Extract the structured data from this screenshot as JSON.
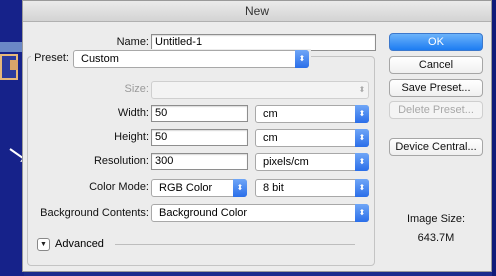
{
  "window": {
    "title": "New"
  },
  "form": {
    "name_label": "Name:",
    "name_value": "Untitled-1",
    "preset_label": "Preset:",
    "preset_value": "Custom",
    "size_label": "Size:",
    "size_value": "",
    "width_label": "Width:",
    "width_value": "50",
    "width_unit": "cm",
    "height_label": "Height:",
    "height_value": "50",
    "height_unit": "cm",
    "resolution_label": "Resolution:",
    "resolution_value": "300",
    "resolution_unit": "pixels/cm",
    "color_mode_label": "Color Mode:",
    "color_mode_value": "RGB Color",
    "bit_depth_value": "8 bit",
    "background_label": "Background Contents:",
    "background_value": "Background Color",
    "advanced_label": "Advanced"
  },
  "buttons": {
    "ok": "OK",
    "cancel": "Cancel",
    "save_preset": "Save Preset...",
    "delete_preset": "Delete Preset...",
    "device_central": "Device Central..."
  },
  "info": {
    "image_size_label": "Image Size:",
    "image_size_value": "643.7M"
  },
  "icons": {
    "popup_arrow": "updown-chevron-icon",
    "advanced_toggle": "disclosure-triangle-icon"
  },
  "colors": {
    "accent": "#2a6ee9",
    "desktop_bg": "#1b2a8c"
  }
}
